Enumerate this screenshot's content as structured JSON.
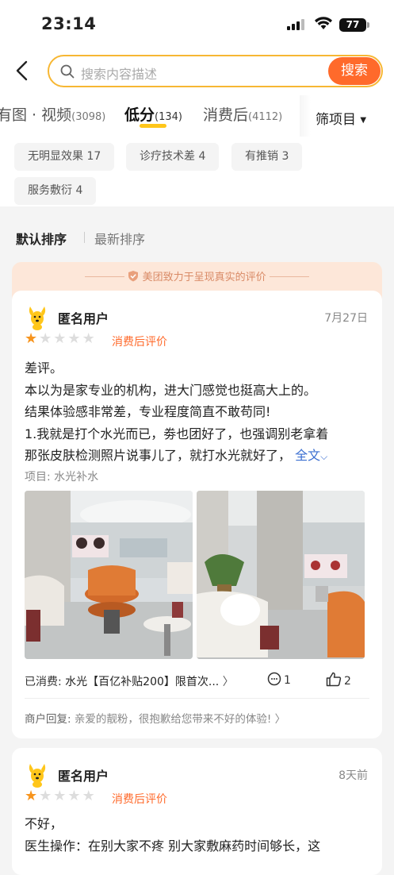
{
  "status_bar": {
    "time": "23:14",
    "battery": "77"
  },
  "search": {
    "placeholder": "搜索内容描述",
    "button": "搜索"
  },
  "tabs": [
    {
      "label": "有图 · 视频",
      "count": "(3098)"
    },
    {
      "label": "低分",
      "count": "(134)"
    },
    {
      "label": "消费后",
      "count": "(4112)"
    }
  ],
  "filter": {
    "label": "筛项目"
  },
  "chips": [
    "无明显效果 17",
    "诊疗技术差 4",
    "有推销 3",
    "服务敷衍 4"
  ],
  "sort": {
    "default": "默认排序",
    "latest": "最新排序"
  },
  "banner": {
    "text": "美团致力于呈现真实的评价"
  },
  "reviews": [
    {
      "user": "匿名用户",
      "date": "7月27日",
      "rating": 1,
      "tag": "消费后评价",
      "lines": [
        "差评。",
        "本以为是家专业的机构，进大门感觉也挺高大上的。",
        "结果体验感非常差，专业程度简直不敢苟同!",
        "1.我就是打个水光而已，劵也团好了，也强调别老拿着",
        "那张皮肤检测照片说事儿了，就打水光就好了，"
      ],
      "more": "全文",
      "project": "项目: 水光补水",
      "consumed_label": "已消费:",
      "consumed_item": "水光【百亿补贴200】限首次...",
      "comments": "1",
      "likes": "2",
      "reply_label": "商户回复:",
      "reply_text": "亲爱的靓粉，很抱歉给您带来不好的体验!"
    },
    {
      "user": "匿名用户",
      "date": "8天前",
      "rating": 1,
      "tag": "消费后评价",
      "lines": [
        "不好，",
        "医生操作：在别大家不疼 别大家敷麻药时间够长，这"
      ]
    }
  ],
  "colors": {
    "accent": "#ff6a2b",
    "star": "#f7941d",
    "tab_underline": "#ffc61a",
    "search_border": "#f7b733"
  }
}
